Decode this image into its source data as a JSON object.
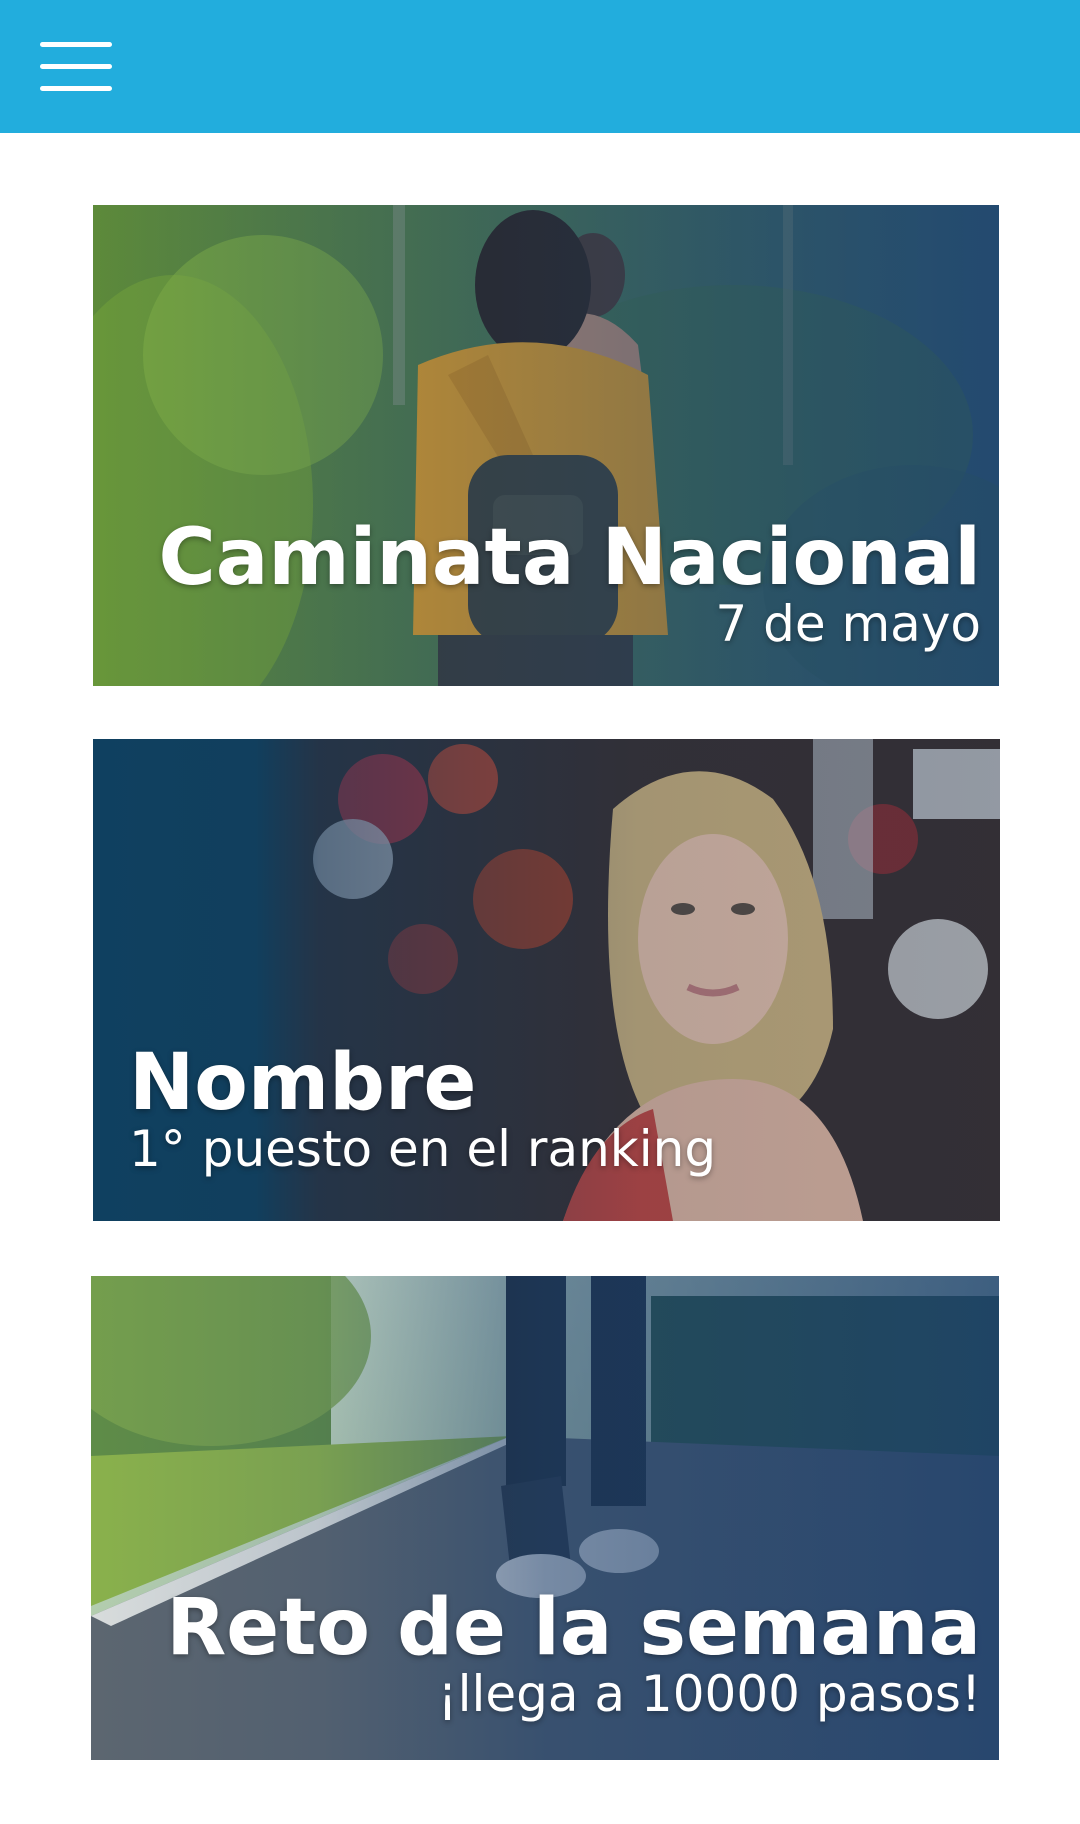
{
  "header": {
    "menu_icon": "hamburger-menu-icon",
    "background_color": "#22addd"
  },
  "cards": [
    {
      "title": "Caminata Nacional",
      "subtitle": "7 de mayo",
      "image": "hikers-walking-forest-trail"
    },
    {
      "title": "Nombre",
      "subtitle": "1° puesto en el ranking",
      "image": "blonde-woman-portrait-flowers"
    },
    {
      "title": "Reto de la semana",
      "subtitle": "¡llega a 10000 pasos!",
      "image": "runner-legs-on-road"
    }
  ],
  "colors": {
    "overlay_blue": "#1b3f6e",
    "text": "#ffffff"
  }
}
